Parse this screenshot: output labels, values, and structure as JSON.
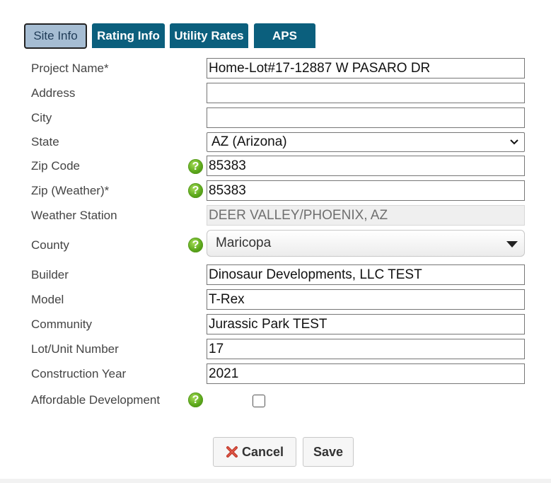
{
  "tabs": [
    {
      "label": "Site Info",
      "active": true
    },
    {
      "label": "Rating Info",
      "active": false
    },
    {
      "label": "Utility Rates",
      "active": false
    },
    {
      "label": "APS",
      "active": false
    }
  ],
  "form": {
    "project_name": {
      "label": "Project Name*",
      "value": "Home-Lot#17-12887 W PASARO DR"
    },
    "address": {
      "label": "Address",
      "value": ""
    },
    "city": {
      "label": "City",
      "value": ""
    },
    "state": {
      "label": "State",
      "value": "AZ (Arizona)"
    },
    "zip_code": {
      "label": "Zip Code",
      "value": "85383"
    },
    "zip_weather": {
      "label": "Zip (Weather)*",
      "value": "85383"
    },
    "weather_station": {
      "label": "Weather Station",
      "value": "DEER VALLEY/PHOENIX, AZ"
    },
    "county": {
      "label": "County",
      "value": "Maricopa"
    },
    "builder": {
      "label": "Builder",
      "value": "Dinosaur Developments, LLC TEST"
    },
    "model": {
      "label": "Model",
      "value": "T-Rex"
    },
    "community": {
      "label": "Community",
      "value": "Jurassic Park TEST"
    },
    "lot_unit": {
      "label": "Lot/Unit Number",
      "value": "17"
    },
    "construction_year": {
      "label": "Construction Year",
      "value": "2021"
    },
    "affordable": {
      "label": "Affordable Development",
      "checked": false
    }
  },
  "actions": {
    "cancel_label": "Cancel",
    "save_label": "Save"
  },
  "icons": {
    "help": "help-icon",
    "cancel": "x-icon",
    "dropdown": "chevron-down-icon"
  },
  "colors": {
    "tab_bg": "#0b5f7d",
    "tab_active_bg": "#a6bdd3",
    "help_green": "#5da91c",
    "cancel_red": "#c0392b"
  }
}
